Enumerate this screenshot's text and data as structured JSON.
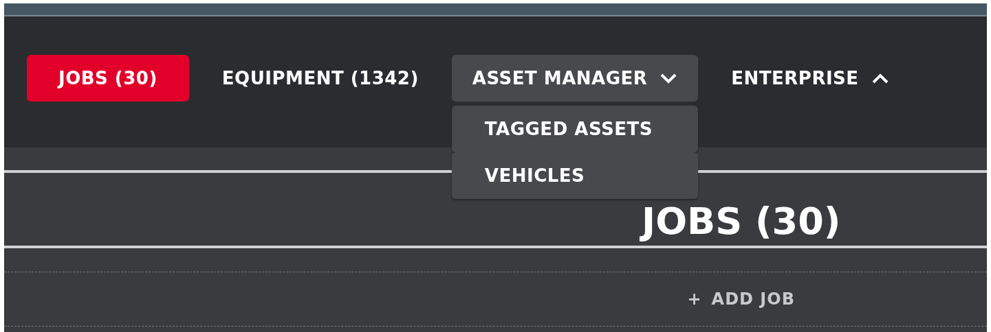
{
  "nav": {
    "tabs": [
      {
        "label": "JOBS (30)",
        "selected": true,
        "kind": "plain"
      },
      {
        "label": "EQUIPMENT (1342)",
        "selected": false,
        "kind": "plain"
      },
      {
        "label": "ASSET MANAGER",
        "selected": false,
        "kind": "dropdown",
        "expanded": true,
        "menu": [
          "TAGGED ASSETS",
          "VEHICLES"
        ]
      },
      {
        "label": "ENTERPRISE",
        "selected": false,
        "kind": "dropdown",
        "expanded": false
      }
    ]
  },
  "heading": "JOBS (30)",
  "add_button": {
    "icon": "+",
    "label": "ADD JOB"
  }
}
